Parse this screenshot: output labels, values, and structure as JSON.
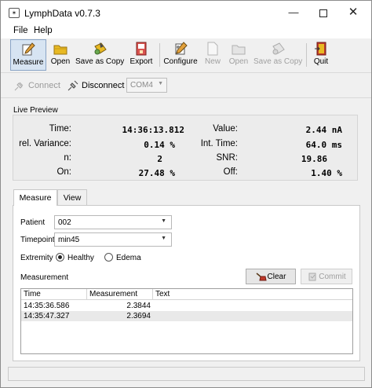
{
  "window": {
    "title": "LymphData v0.7.3",
    "app_icon": "✶",
    "minimize": "—",
    "close": "✕"
  },
  "menu": [
    "File",
    "Help"
  ],
  "toolbar": {
    "buttons": [
      {
        "label": "Measure",
        "icon": "pencil-icon",
        "active": true,
        "enabled": true
      },
      {
        "label": "Open",
        "icon": "folder-icon",
        "active": false,
        "enabled": true
      },
      {
        "label": "Save as Copy",
        "icon": "save-copy-icon",
        "active": false,
        "enabled": true
      },
      {
        "label": "Export",
        "icon": "export-icon",
        "active": false,
        "enabled": true
      },
      {
        "label": "Configure",
        "icon": "configure-icon",
        "active": false,
        "enabled": true
      },
      {
        "label": "New",
        "icon": "new-file-icon",
        "active": false,
        "enabled": false
      },
      {
        "label": "Open",
        "icon": "open-disabled-icon",
        "active": false,
        "enabled": false
      },
      {
        "label": "Save as Copy",
        "icon": "save-copy-disabled-icon",
        "active": false,
        "enabled": false
      },
      {
        "label": "Quit",
        "icon": "quit-icon",
        "active": false,
        "enabled": true
      }
    ]
  },
  "connection": {
    "connect_label": "Connect",
    "disconnect_label": "Disconnect",
    "port": "COM4"
  },
  "live_preview": {
    "title": "Live Preview",
    "time_label": "Time:",
    "time_value": "14:36:13.812",
    "value_label": "Value:",
    "value_value": "2.44 nA",
    "relvar_label": "rel. Variance:",
    "relvar_value": "0.14 %",
    "inttime_label": "Int. Time:",
    "inttime_value": "64.0 ms",
    "n_label": "n:",
    "n_value": "2",
    "snr_label": "SNR:",
    "snr_value": "19.86",
    "on_label": "On:",
    "on_value": "27.48 %",
    "off_label": "Off:",
    "off_value": "1.40 %"
  },
  "tabs": [
    "Measure",
    "View"
  ],
  "form": {
    "patient_label": "Patient",
    "patient_value": "002",
    "timepoint_label": "Timepoint",
    "timepoint_value": "min45",
    "extremity_label": "Extremity",
    "extremity_options": [
      "Healthy",
      "Edema"
    ],
    "extremity_selected": "Healthy",
    "measurement_label": "Measurement",
    "clear_label": "Clear",
    "commit_label": "Commit"
  },
  "table": {
    "columns": [
      "Time",
      "Measurement",
      "Text"
    ],
    "rows": [
      {
        "time": "14:35:36.586",
        "measurement": "2.3844",
        "text": ""
      },
      {
        "time": "14:35:47.327",
        "measurement": "2.3694",
        "text": ""
      }
    ]
  },
  "colors": {
    "window_bg": "#f0f0f0",
    "active_tool_bg": "#d7e4f2",
    "active_tool_border": "#8aa4c6",
    "quit_red": "#c0392b",
    "folder_yellow": "#e8b923"
  }
}
